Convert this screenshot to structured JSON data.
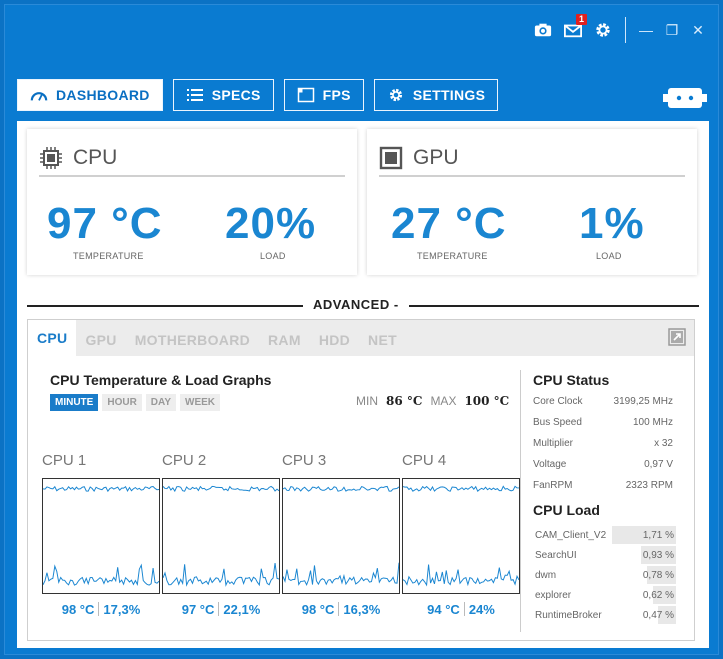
{
  "titlebar": {
    "icons": [
      "camera-icon",
      "mail-icon",
      "gear-icon"
    ],
    "mail_badge": "1"
  },
  "nav": [
    {
      "label": "DASHBOARD",
      "icon": "speedometer-icon",
      "active": true
    },
    {
      "label": "SPECS",
      "icon": "list-icon",
      "active": false
    },
    {
      "label": "FPS",
      "icon": "window-icon",
      "active": false
    },
    {
      "label": "SETTINGS",
      "icon": "gear-icon",
      "active": false
    }
  ],
  "cpu_card": {
    "title": "CPU",
    "temp": "97 °C",
    "temp_label": "TEMPERATURE",
    "load": "20%",
    "load_label": "LOAD"
  },
  "gpu_card": {
    "title": "GPU",
    "temp": "27 °C",
    "temp_label": "TEMPERATURE",
    "load": "1%",
    "load_label": "LOAD"
  },
  "advanced": {
    "label": "ADVANCED -"
  },
  "tabs": [
    "CPU",
    "GPU",
    "MOTHERBOARD",
    "RAM",
    "HDD",
    "NET"
  ],
  "graphs": {
    "title": "CPU Temperature & Load Graphs",
    "ranges": [
      "MINUTE",
      "HOUR",
      "DAY",
      "WEEK"
    ],
    "min_label": "MIN",
    "min_value": "86 °C",
    "max_label": "MAX",
    "max_value": "100 °C",
    "cores": [
      {
        "name": "CPU 1",
        "temp": "98 °C",
        "load": "17,3%"
      },
      {
        "name": "CPU 2",
        "temp": "97 °C",
        "load": "22,1%"
      },
      {
        "name": "CPU 3",
        "temp": "98 °C",
        "load": "16,3%"
      },
      {
        "name": "CPU 4",
        "temp": "94 °C",
        "load": "24%"
      }
    ]
  },
  "cpu_status": {
    "title": "CPU Status",
    "rows": [
      {
        "key": "Core Clock",
        "value": "3199,25 MHz"
      },
      {
        "key": "Bus Speed",
        "value": "100 MHz"
      },
      {
        "key": "Multiplier",
        "value": "x 32"
      },
      {
        "key": "Voltage",
        "value": "0,97 V"
      },
      {
        "key": "FanRPM",
        "value": "2323 RPM"
      }
    ]
  },
  "cpu_load": {
    "title": "CPU Load",
    "rows": [
      {
        "name": "CAM_Client_V2",
        "value": "1,71 %",
        "pct": 1.71
      },
      {
        "name": "SearchUI",
        "value": "0,93 %",
        "pct": 0.93
      },
      {
        "name": "dwm",
        "value": "0,78 %",
        "pct": 0.78
      },
      {
        "name": "explorer",
        "value": "0,62 %",
        "pct": 0.62
      },
      {
        "name": "RuntimeBroker",
        "value": "0,47 %",
        "pct": 0.47
      }
    ]
  },
  "colors": {
    "accent": "#1a86d1",
    "window": "#0a7bd1"
  }
}
